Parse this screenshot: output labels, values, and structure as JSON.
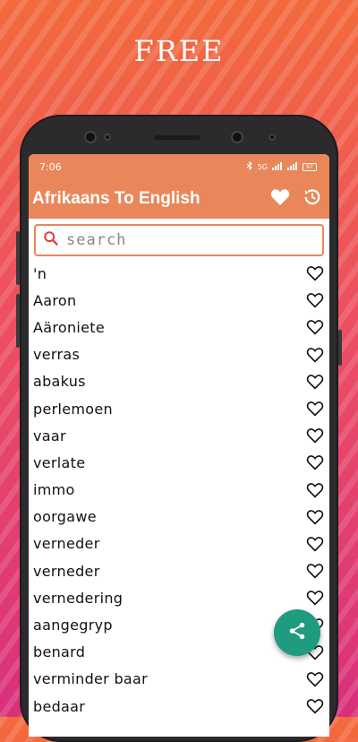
{
  "promo": {
    "title": "FREE"
  },
  "status_bar": {
    "time": "7:06",
    "network": "5G",
    "battery": "97"
  },
  "app_bar": {
    "title": "Afrikaans To English"
  },
  "search": {
    "placeholder": "search"
  },
  "words": [
    "'n",
    "Aaron",
    "Aäroniete",
    "verras",
    "abakus",
    "perlemoen",
    "vaar",
    "verlate",
    "immo",
    "oorgawe",
    "verneder",
    "verneder",
    "vernedering",
    "aangegryp",
    "benard",
    "verminder baar",
    "bedaar"
  ],
  "colors": {
    "accent": "#e9875a",
    "fab": "#1f9b7f"
  },
  "icons": {
    "favorites": "heart-filled-icon",
    "history": "history-icon",
    "search": "search-icon",
    "row_favorite": "heart-outline-icon",
    "share": "share-icon"
  }
}
